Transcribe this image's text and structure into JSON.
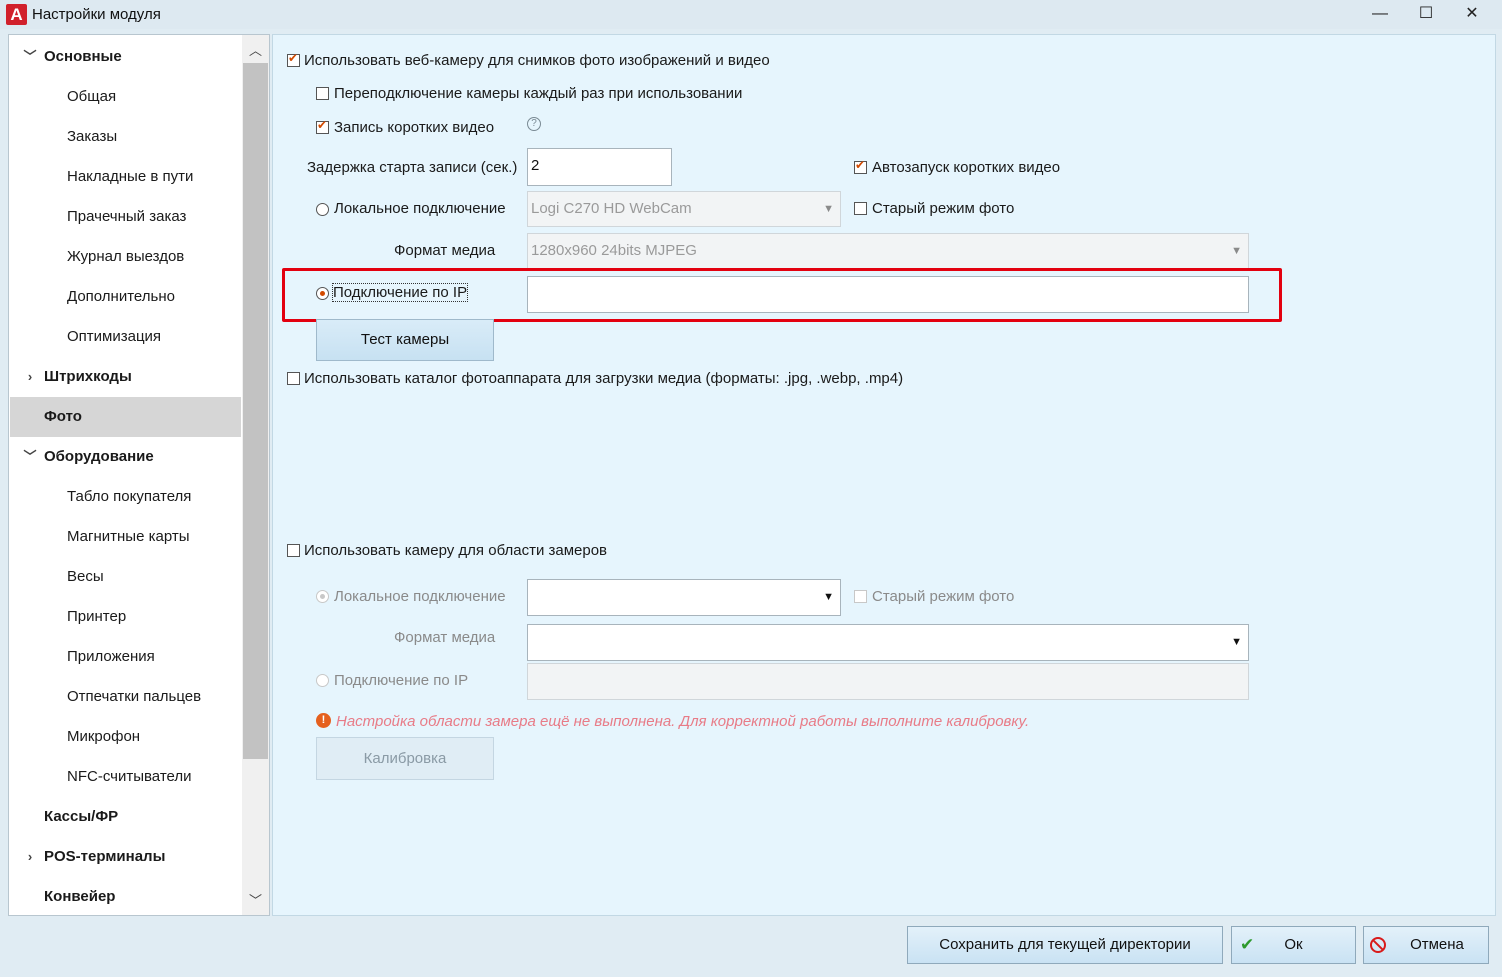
{
  "window": {
    "title": "Настройки модуля",
    "logo_letter": "A",
    "minimize_glyph": "—",
    "maximize_glyph": "☐",
    "close_glyph": "✕"
  },
  "tree": {
    "items": [
      {
        "label": "Основные",
        "group": true,
        "caret": "﹀"
      },
      {
        "label": "Общая"
      },
      {
        "label": "Заказы"
      },
      {
        "label": "Накладные в пути"
      },
      {
        "label": "Прачечный заказ"
      },
      {
        "label": "Журнал выездов"
      },
      {
        "label": "Дополнительно"
      },
      {
        "label": "Оптимизация"
      },
      {
        "label": "Штрихкоды",
        "group": true,
        "caret": "›"
      },
      {
        "label": "Фото",
        "group": true,
        "selected": true
      },
      {
        "label": "Оборудование",
        "group": true,
        "caret": "﹀"
      },
      {
        "label": "Табло покупателя"
      },
      {
        "label": "Магнитные карты"
      },
      {
        "label": "Весы"
      },
      {
        "label": "Принтер"
      },
      {
        "label": "Приложения"
      },
      {
        "label": "Отпечатки пальцев"
      },
      {
        "label": "Микрофон"
      },
      {
        "label": "NFC-считыватели"
      },
      {
        "label": "Кассы/ФР",
        "group": true
      },
      {
        "label": "POS-терминалы",
        "group": true,
        "caret": "›"
      },
      {
        "label": "Конвейер",
        "group": true
      }
    ],
    "scroll_up": "︿",
    "scroll_down": "﹀"
  },
  "webcam": {
    "use_webcam_label": "Использовать веб-камеру для снимков фото изображений и видео",
    "use_webcam_checked": true,
    "reconnect_label": "Переподключение камеры каждый раз при использовании",
    "reconnect_checked": false,
    "short_video_label": "Запись коротких видео",
    "short_video_checked": true,
    "help_glyph": "?",
    "delay_label": "Задержка старта записи (сек.)",
    "delay_value": "2",
    "autostart_label": "Автозапуск коротких видео",
    "autostart_checked": true,
    "local_label": "Локальное подключение",
    "local_device": "Logi C270 HD WebCam",
    "old_mode_label": "Старый режим фото",
    "old_mode_checked": false,
    "media_format_label": "Формат медиа",
    "media_format_value": "1280x960 24bits MJPEG",
    "ip_label": "Подключение по IP",
    "ip_selected": true,
    "ip_value": "",
    "test_button": "Тест камеры"
  },
  "camera_catalog": {
    "label": "Использовать каталог фотоаппарата для загрузки медиа (форматы: .jpg, .webp, .mp4)",
    "checked": false
  },
  "measure": {
    "use_label": "Использовать камеру для области замеров",
    "use_checked": false,
    "local_label": "Локальное подключение",
    "local_device": "",
    "old_mode_label": "Старый режим фото",
    "media_format_label": "Формат медиа",
    "media_format_value": "",
    "ip_label": "Подключение по IP",
    "ip_value": "",
    "warning_glyph": "!",
    "warning_text": "Настройка области замера ещё не выполнена. Для корректной работы выполните калибровку.",
    "calibrate_button": "Калибровка"
  },
  "footer": {
    "save_dir_button": "Сохранить для текущей директории",
    "ok_button": "Ок",
    "ok_glyph": "✔",
    "cancel_button": "Отмена"
  },
  "colors": {
    "accent": "#d24a00",
    "highlight": "#e3000f",
    "warning_text": "#e87b87"
  }
}
